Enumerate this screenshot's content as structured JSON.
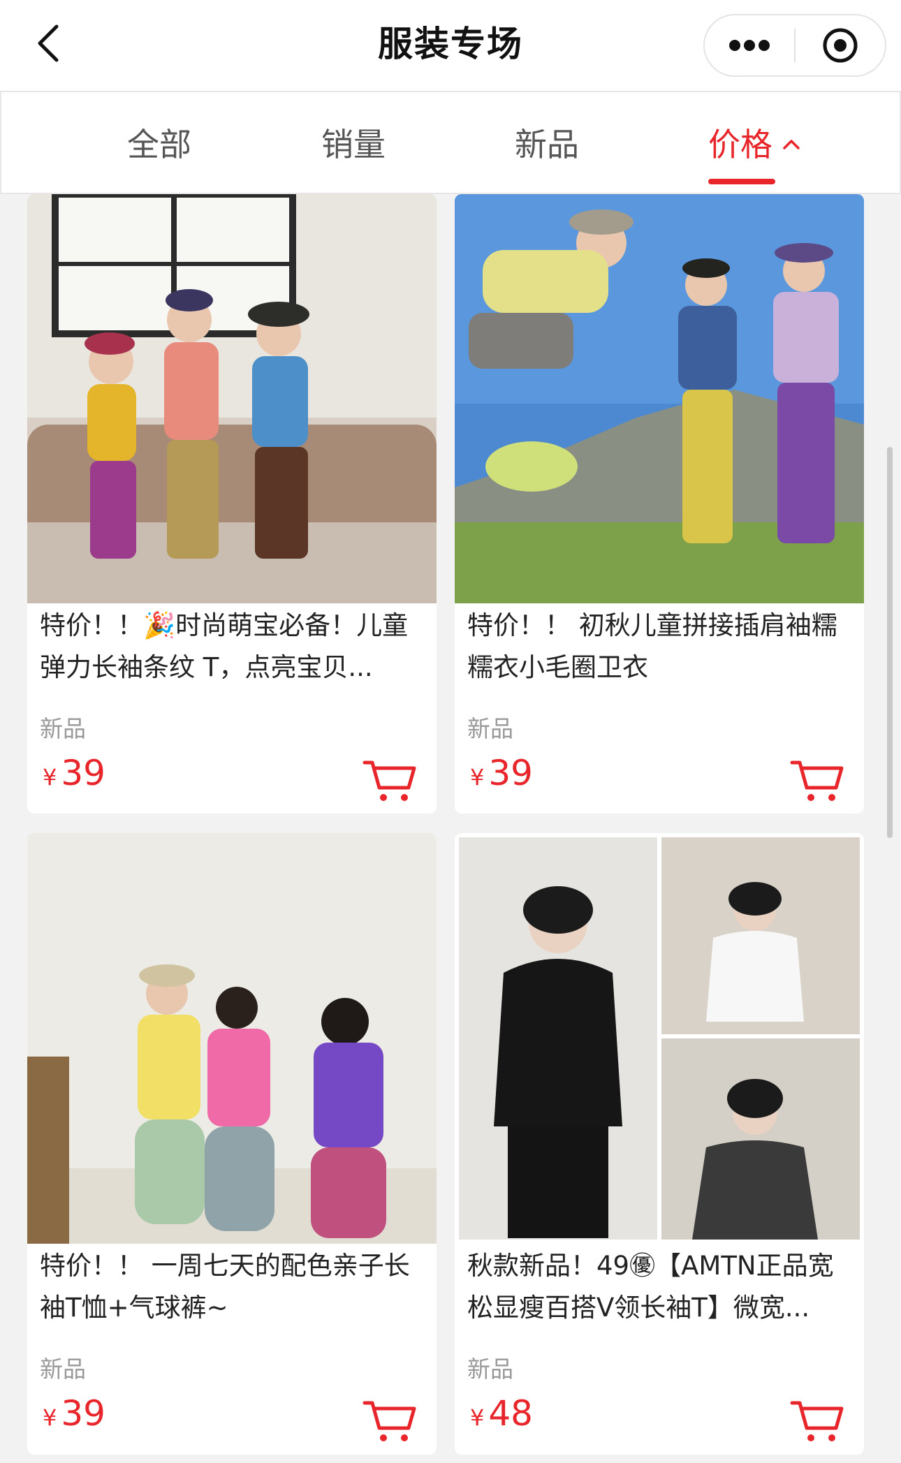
{
  "header": {
    "title": "服装专场",
    "back_icon": "chevron-left-icon",
    "more_icon": "more-dots-icon",
    "target_icon": "target-circle-icon"
  },
  "tabs": [
    {
      "label": "全部",
      "active": false
    },
    {
      "label": "销量",
      "active": false
    },
    {
      "label": "新品",
      "active": false
    },
    {
      "label": "价格",
      "active": true,
      "icon": "chevron-up-icon"
    }
  ],
  "products": [
    {
      "title": "特价！！🎉时尚萌宝必备！儿童弹力长袖条纹 T，点亮宝贝...",
      "tag": "新品",
      "currency": "¥",
      "price": "39"
    },
    {
      "title": "特价！！ 初秋儿童拼接插肩袖糯糯衣小毛圈卫衣",
      "tag": "新品",
      "currency": "¥",
      "price": "39"
    },
    {
      "title": "特价！！ 一周七天的配色亲子长袖T恤+气球裤~",
      "tag": "新品",
      "currency": "¥",
      "price": "39"
    },
    {
      "title": "秋款新品！49㊝【AMTN正品宽松显瘦百搭V领长袖T】微宽...",
      "tag": "新品",
      "currency": "¥",
      "price": "48"
    }
  ],
  "colors": {
    "accent": "#e8252a",
    "tag_gray": "#999999",
    "bg": "#f2f2f2"
  }
}
